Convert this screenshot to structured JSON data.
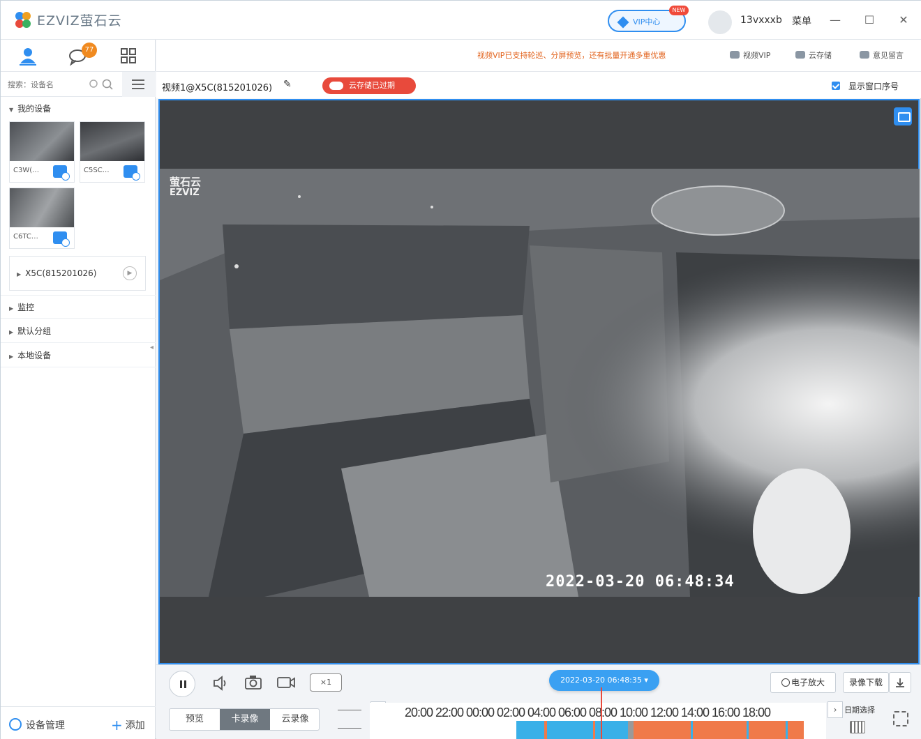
{
  "app": {
    "logo_text": "EZVIZ萤石云",
    "vip_button": "VIP中心",
    "new_badge": "NEW",
    "username": "13vxxxb",
    "menu_label": "菜单",
    "window_controls": [
      "—",
      "☐",
      "✕"
    ]
  },
  "sidebar": {
    "tabs": [
      "person-icon",
      "message-icon",
      "grid-icon"
    ],
    "message_count": "77",
    "search_placeholder": "搜索：设备名",
    "my_devices_label": "我的设备",
    "devices": [
      {
        "label": "C3W(…",
        "kind": "thumbnail"
      },
      {
        "label": "C5SC…",
        "kind": "thumbnail"
      },
      {
        "label": "C6TC…",
        "kind": "thumbnail"
      }
    ],
    "selected_device": "X5C(815201026)",
    "groups": [
      "监控",
      "默认分组",
      "本地设备"
    ],
    "device_management": "设备管理",
    "add_label": "添加"
  },
  "topstrip": {
    "promo": "视频VIP已支持轮巡、分屏预览，还有批量开通多重优惠",
    "links": [
      "视频VIP",
      "云存储",
      "意见留言"
    ]
  },
  "video_header": {
    "title": "视频1@X5C(815201026)",
    "cloud_status": "云存储已过期",
    "show_window_index": "显示窗口序号"
  },
  "video": {
    "cam_logo_top": "萤石云",
    "cam_logo_bottom": "EZVIZ",
    "timestamp": "2022-03-20 06:48:34"
  },
  "controls": {
    "speed": "×1",
    "current_datetime": "2022-03-20 06:48:35 ▾",
    "digital_zoom": "电子放大",
    "record_download": "录像下载",
    "modes": [
      "预览",
      "卡录像",
      "云录像"
    ],
    "active_mode": "卡录像",
    "timeline_labels": [
      "20:00",
      "22:00",
      "00:00",
      "02:00",
      "04:00",
      "06:00",
      "08:00",
      "10:00",
      "12:00",
      "14:00",
      "16:00",
      "18:00"
    ],
    "date_select": "日期选择",
    "colors": {
      "accent": "#2f8ef0",
      "alarm": "#f07a4a",
      "normal": "#3ab0e8",
      "cursor": "#e84a3c"
    }
  }
}
